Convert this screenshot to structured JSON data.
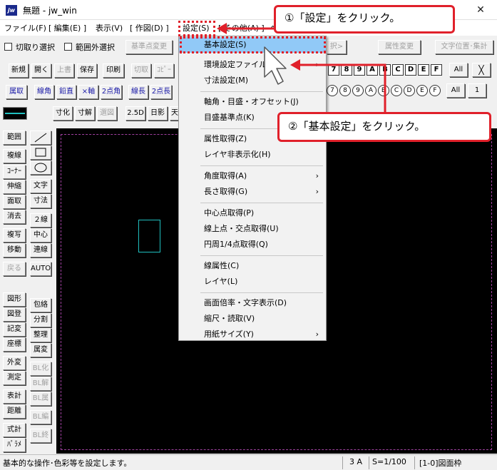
{
  "window": {
    "app_icon": "jw",
    "title": "無題 - jw_win",
    "minimize": "—",
    "maximize": "☐",
    "close": "✕"
  },
  "menubar": [
    {
      "label": "ファイル(F)"
    },
    {
      "label": "[ 編集(E) ]"
    },
    {
      "label": "表示(V)"
    },
    {
      "label": "[ 作図(D) ]"
    },
    {
      "label": "設定(S)"
    },
    {
      "label": "[ その他(A) ]"
    },
    {
      "label": "ヘ"
    }
  ],
  "optbar": {
    "cut_select": "切取り選択",
    "range_out_select": "範囲外選択",
    "base_point_change": "基準点変更",
    "attr_change": "属性変更",
    "text_pos": "文字位置･集計",
    "partial": "択>"
  },
  "toolbar1": [
    "新規",
    "開く",
    "上書",
    "保存",
    "印刷",
    "切取",
    "ｺﾋﾟｰ",
    "ﾍﾟ"
  ],
  "toolbar2": [
    "属取",
    "線角",
    "鉛直",
    "×軸",
    "2点角",
    "線長",
    "2点長",
    "間"
  ],
  "toolbar3": [
    "寸化",
    "寸解",
    "選図",
    "2.5D",
    "日影",
    "天"
  ],
  "layer_squares": [
    "7",
    "8",
    "9",
    "A",
    "B",
    "C",
    "D",
    "E",
    "F"
  ],
  "layer_circles": [
    "7",
    "8",
    "9",
    "A",
    "B",
    "C",
    "D",
    "E",
    "F"
  ],
  "layer_all": "All",
  "layer_x": "╳",
  "layer_one": "1",
  "sidetools": {
    "left": [
      "範囲",
      "複線",
      "ｺｰﾅｰ",
      "伸縮",
      "面取",
      "消去",
      "複写",
      "移動",
      "戻る",
      "図形",
      "図登",
      "記変",
      "座標",
      "外変",
      "測定",
      "表計",
      "距離",
      "式計",
      "ﾊﾟﾗﾒ"
    ],
    "right_mid": [
      "文字",
      "寸法",
      "２線",
      "中心線",
      "連線",
      "AUTO"
    ],
    "right_low": [
      "包絡",
      "分割",
      "整理",
      "属変",
      "BL化",
      "BL解",
      "BL属",
      "BL編",
      "BL終"
    ]
  },
  "dropdown": {
    "items": [
      {
        "label": "基本設定(S)",
        "selected": true
      },
      {
        "label": "環境設定ファイル",
        "submenu": true
      },
      {
        "label": "寸法設定(M)"
      },
      {
        "label": "軸角・目盛・オフセット(J)"
      },
      {
        "label": "目盛基準点(K)"
      },
      {
        "label": "属性取得(Z)"
      },
      {
        "label": "レイヤ非表示化(H)"
      },
      {
        "label": "角度取得(A)",
        "submenu": true
      },
      {
        "label": "長さ取得(G)",
        "submenu": true
      },
      {
        "label": "中心点取得(P)"
      },
      {
        "label": "線上点・交点取得(U)"
      },
      {
        "label": "円周1/4点取得(Q)"
      },
      {
        "label": "線属性(C)"
      },
      {
        "label": "レイヤ(L)"
      },
      {
        "label": "画面倍率・文字表示(D)"
      },
      {
        "label": "縮尺・読取(V)"
      },
      {
        "label": "用紙サイズ(Y)",
        "submenu": true
      }
    ],
    "submenu_arrow": "›"
  },
  "callouts": {
    "step1": "①「設定」をクリック。",
    "step2": "②「基本設定」をクリック。"
  },
  "statusbar": {
    "message": "基本的な操作･色彩等を設定します。",
    "size": "3 A",
    "scale": "S=1/100",
    "frame": "[1-0]図面枠"
  },
  "colors": {
    "accent_red": "#e0202a",
    "menu_highlight": "#91c9f7",
    "canvas": "#000000",
    "cyan_shape": "#20c0c0"
  }
}
